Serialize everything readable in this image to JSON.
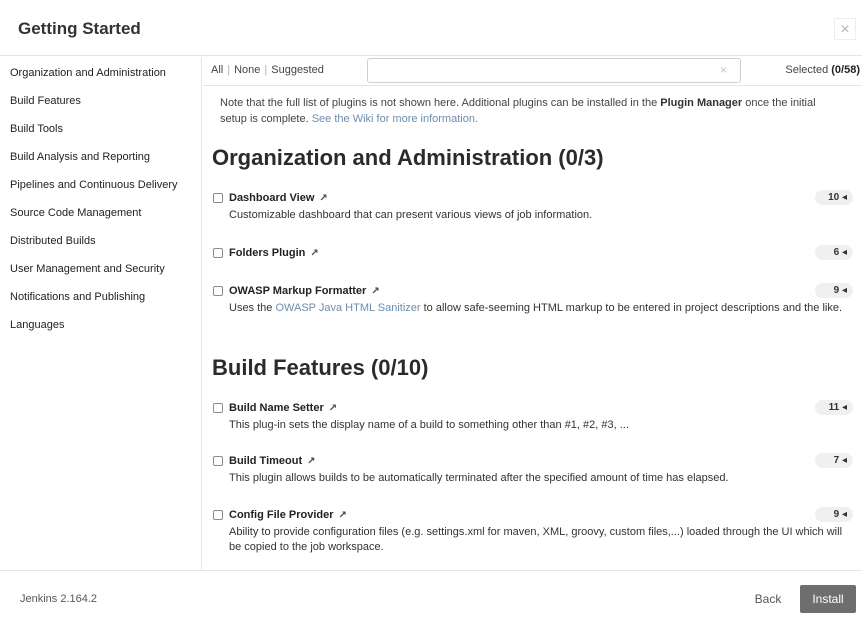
{
  "header": {
    "title": "Getting Started",
    "close_label": "×"
  },
  "sidebar": {
    "items": [
      {
        "label": "Organization and Administration"
      },
      {
        "label": "Build Features"
      },
      {
        "label": "Build Tools"
      },
      {
        "label": "Build Analysis and Reporting"
      },
      {
        "label": "Pipelines and Continuous Delivery"
      },
      {
        "label": "Source Code Management"
      },
      {
        "label": "Distributed Builds"
      },
      {
        "label": "User Management and Security"
      },
      {
        "label": "Notifications and Publishing"
      },
      {
        "label": "Languages"
      }
    ]
  },
  "toolbar": {
    "all_label": "All",
    "none_label": "None",
    "suggested_label": "Suggested",
    "separator": "|",
    "search_value": "",
    "search_placeholder": "",
    "clear_label": "×",
    "selected_label": "Selected",
    "selected_count": "(0/58)"
  },
  "note": {
    "text_1": "Note that the full list of plugins is not shown here. Additional plugins can be installed in the ",
    "plugin_manager": "Plugin Manager",
    "text_2": " once the initial setup is complete. ",
    "wiki_link": "See the Wiki for more information."
  },
  "sections": [
    {
      "title": "Organization and Administration (0/3)",
      "plugins": [
        {
          "name": "Dashboard View",
          "ext": "↗",
          "deps": "10 ◂",
          "desc": "Customizable dashboard that can present various views of job information."
        },
        {
          "name": "Folders Plugin",
          "ext": "↗",
          "deps": "6 ◂",
          "desc": ""
        },
        {
          "name": "OWASP Markup Formatter",
          "ext": "↗",
          "deps": "9 ◂",
          "desc_1": "Uses the ",
          "desc_link": "OWASP Java HTML Sanitizer",
          "desc_2": " to allow safe-seeming HTML markup to be entered in project descriptions and the like."
        }
      ]
    },
    {
      "title": "Build Features (0/10)",
      "plugins": [
        {
          "name": "Build Name Setter",
          "ext": "↗",
          "deps": "11 ◂",
          "desc": "This plug-in sets the display name of a build to something other than #1, #2, #3, ..."
        },
        {
          "name": "Build Timeout",
          "ext": "↗",
          "deps": "7 ◂",
          "desc": "This plugin allows builds to be automatically terminated after the specified amount of time has elapsed."
        },
        {
          "name": "Config File Provider",
          "ext": "↗",
          "deps": "9 ◂",
          "desc": "Ability to provide configuration files (e.g. settings.xml for maven, XML, groovy, custom files,...) loaded through the UI which will be copied to the job workspace."
        }
      ]
    }
  ],
  "footer": {
    "version": "Jenkins 2.164.2",
    "back_label": "Back",
    "install_label": "Install"
  },
  "colors": {
    "link": "#6c8dad",
    "install_bg": "#6e6e6e",
    "badge_bg": "#f0f0f0"
  }
}
